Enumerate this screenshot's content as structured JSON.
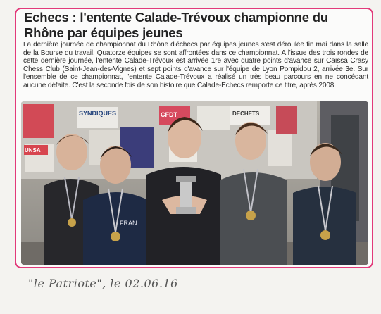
{
  "article": {
    "headline": "Echecs : l'entente Calade-Trévoux championne du Rhône par équipes jeunes",
    "body": "La dernière journée de championnat du Rhône d'échecs par équipes jeunes s'est déroulée fin mai dans la salle de la Bourse du travail. Quatorze équipes se sont affrontées dans ce championnat. A l'issue des trois rondes de cette dernière journée, l'entente Calade-Trévoux est arrivée 1re avec quatre points d'avance sur Caïssa Crasy Chess Club (Saint-Jean-des-Vignes) et sept points d'avance sur l'équipe de Lyon Pompidou 2, arrivée 3e. Sur l'ensemble de ce championnat, l'entente Calade-Trévoux a réalisé un très beau parcours en ne concédant aucune défaite. C'est la seconde fois de son histoire que Calade-Echecs remporte ce titre, après 2008."
  },
  "photo": {
    "poster_texts": [
      "SYNDIQUES",
      "CFDT",
      "DECHETS",
      "UNSA"
    ],
    "shirt_text": "FRAN"
  },
  "caption": "\"le Patriote\", le 02.06.16"
}
